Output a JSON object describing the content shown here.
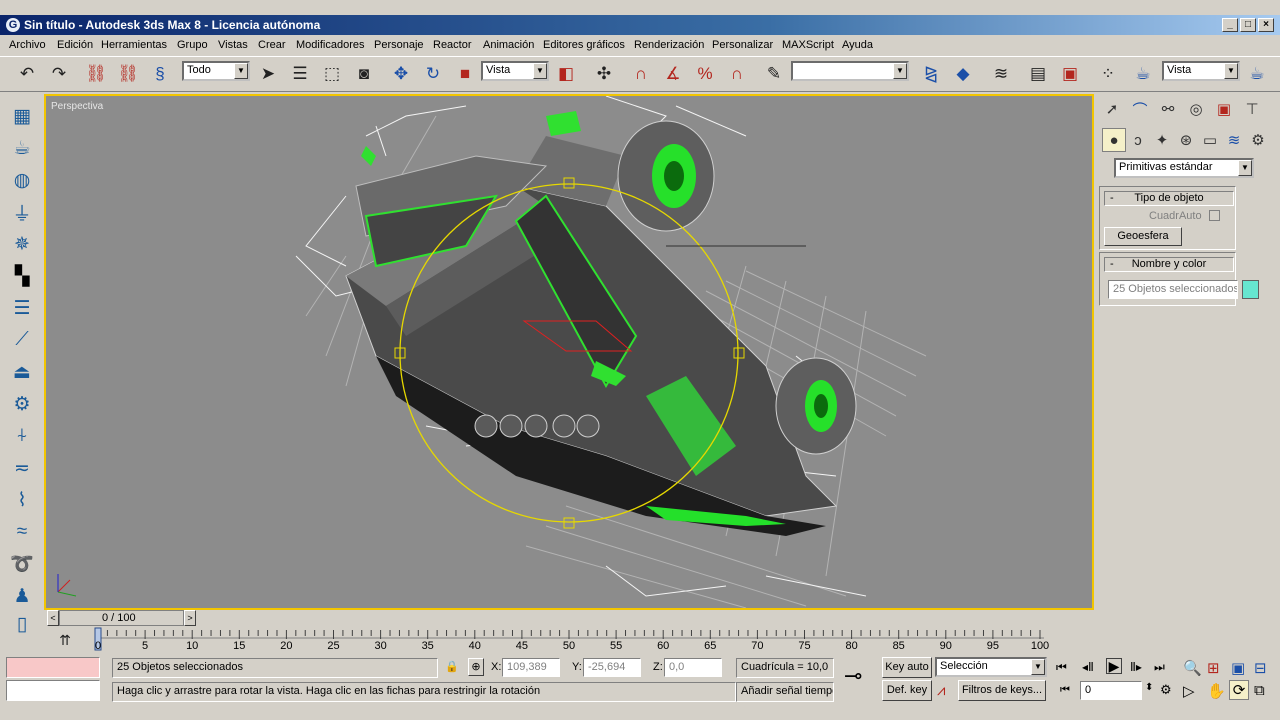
{
  "window": {
    "title": "Sin título - Autodesk 3ds Max 8 - Licencia autónoma",
    "min": "_",
    "max": "□",
    "close": "×"
  },
  "menu": [
    "Archivo",
    "Edición",
    "Herramientas",
    "Grupo",
    "Vistas",
    "Crear",
    "Modificadores",
    "Personaje",
    "Reactor",
    "Animación",
    "Editores gráficos",
    "Renderización",
    "Personalizar",
    "MAXScript",
    "Ayuda"
  ],
  "toolbar": {
    "selection_filter": "Todo",
    "ref_coord": "Vista",
    "named_selection": "",
    "render_view": "Vista"
  },
  "viewport": {
    "label": "Perspectiva",
    "active_border_color": "#f2c500"
  },
  "command_panel": {
    "category": "Primitivas estándar",
    "object_type_title": "Tipo de objeto",
    "autogrid": "CuadrAuto",
    "geosphere": "Geoesfera",
    "name_color_title": "Nombre y color",
    "name_value": "25 Objetos seleccionados",
    "swatch_color": "#66e6d0"
  },
  "time": {
    "slider": "0 / 100",
    "ticks": [
      "0",
      "5",
      "10",
      "15",
      "20",
      "25",
      "30",
      "35",
      "40",
      "45",
      "50",
      "55",
      "60",
      "65",
      "70",
      "75",
      "80",
      "85",
      "90",
      "95",
      "100"
    ]
  },
  "status": {
    "selection": "25 Objetos seleccionados",
    "prompt": "Haga clic y arrastre para rotar la vista. Haga clic en las fichas para restringir la rotación",
    "x_label": "X:",
    "x": "109,389",
    "y_label": "Y:",
    "y": "-25,694",
    "z_label": "Z:",
    "z": "0,0",
    "grid": "Cuadrícula = 10,0",
    "time_tag": "Añadir señal tiempo",
    "key_auto": "Key auto",
    "key_set": "Def. key",
    "key_mode": "Selección",
    "key_filters": "Filtros de keys...",
    "frame": "0"
  }
}
